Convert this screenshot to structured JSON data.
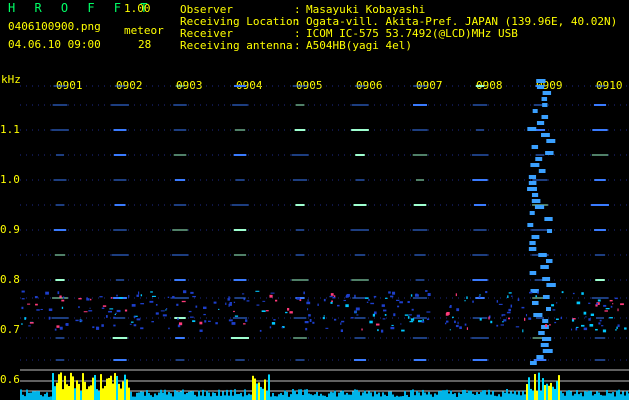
{
  "header": {
    "title": "H R O F F T",
    "version": "1.00",
    "filename": "0406100900.png",
    "meteor_label": "meteor",
    "datetime": "04.06.10 09:00",
    "meteor_count": "28"
  },
  "info": [
    {
      "key": "Observer",
      "value": "Masayuki Kobayashi"
    },
    {
      "key": "Receiving Location",
      "value": "Ogata-vill. Akita-Pref. JAPAN (139.96E, 40.02N)"
    },
    {
      "key": "Receiver",
      "value": "ICOM IC-575 53.7492(@LCD)MHz USB"
    },
    {
      "key": "Receiving antenna",
      "value": "A504HB(yagi 4el)"
    }
  ],
  "spectrogram": {
    "y_unit": "kHz",
    "y_ticks": [
      "1.1",
      "1.0",
      "0.9",
      "0.8",
      "0.7",
      "0.6"
    ],
    "time_ticks": [
      "0901",
      "0902",
      "0903",
      "0904",
      "0905",
      "0906",
      "0907",
      "0908",
      "0909",
      "0910"
    ],
    "colors": {
      "background": "#000000",
      "text": "#ffff00",
      "accent": "#00ff66",
      "signal": "#00d8ff",
      "strong": "#ffff00"
    }
  }
}
